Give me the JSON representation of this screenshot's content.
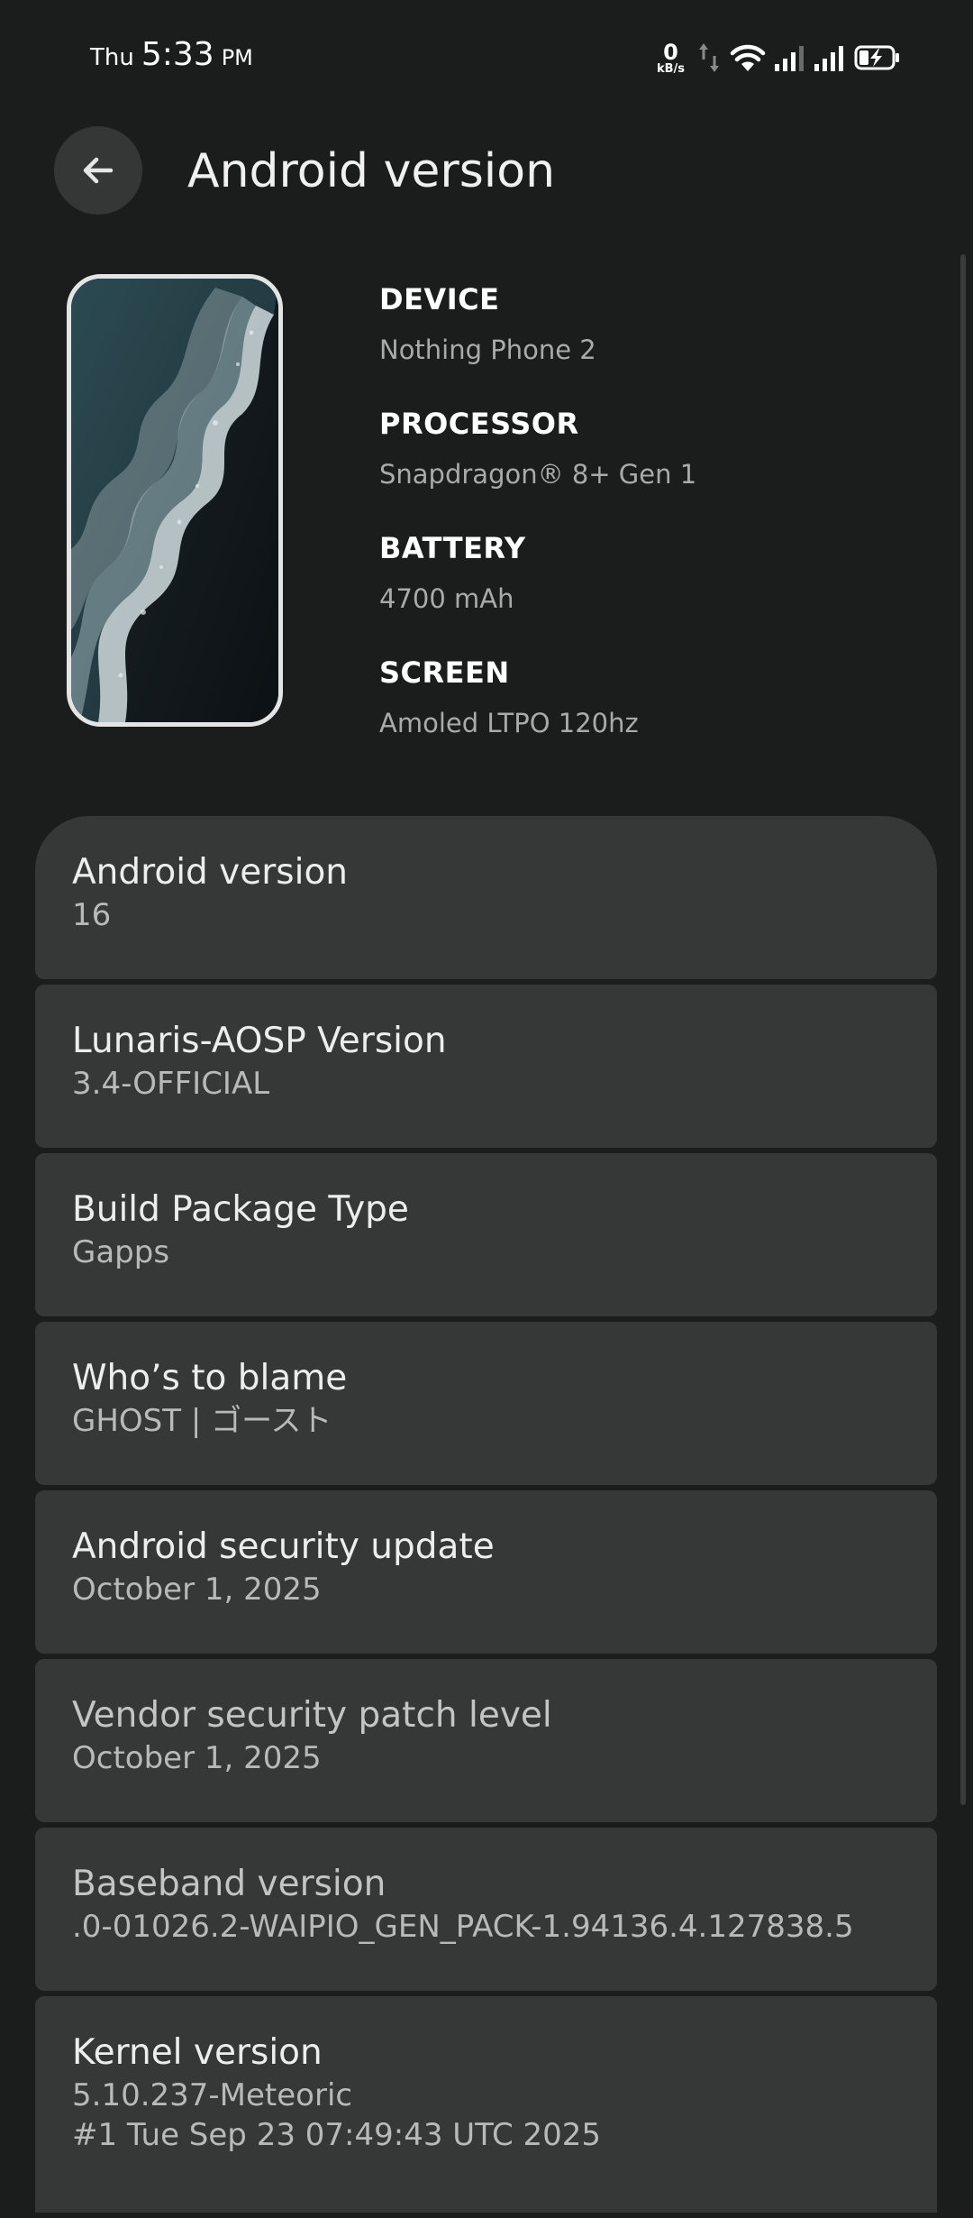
{
  "status_bar": {
    "day": "Thu",
    "time": "5:33",
    "ampm": "PM",
    "net_speed": "0",
    "net_unit": "kB/s",
    "icons": [
      "data-transfer-arrows-icon",
      "wifi-icon",
      "signal-sim1-icon",
      "signal-sim2-icon",
      "battery-charging-icon"
    ]
  },
  "header": {
    "title": "Android version",
    "back_icon": "arrow-left-icon"
  },
  "device_card": {
    "wallpaper": "phone-wallpaper-beach-waves",
    "specs": [
      {
        "label": "DEVICE",
        "value": "Nothing Phone 2"
      },
      {
        "label": "PROCESSOR",
        "value": "Snapdragon® 8+ Gen 1"
      },
      {
        "label": "BATTERY",
        "value": "4700 mAh"
      },
      {
        "label": "SCREEN",
        "value": "Amoled LTPO 120hz"
      }
    ]
  },
  "info_items": [
    {
      "title": "Android version",
      "value": "16"
    },
    {
      "title": "Lunaris-AOSP Version",
      "value": "3.4-OFFICIAL"
    },
    {
      "title": "Build Package Type",
      "value": "Gapps"
    },
    {
      "title": "Who’s to blame",
      "value": "GHOST | ゴースト"
    },
    {
      "title": "Android security update",
      "value": "October 1, 2025"
    },
    {
      "title": "Vendor security patch level",
      "value": "October 1, 2025"
    },
    {
      "title": "Baseband version",
      "value": ".0-01026.2-WAIPIO_GEN_PACK-1.94136.4.127838.5"
    },
    {
      "title": "Kernel version",
      "value": "5.10.237-Meteoric\n#1 Tue Sep 23 07:49:43 UTC 2025"
    }
  ],
  "colors": {
    "background": "#1b1c1c",
    "card": "#363737",
    "back_button": "#353636",
    "text_primary": "#ededed",
    "text_secondary": "#b8b9b9"
  }
}
